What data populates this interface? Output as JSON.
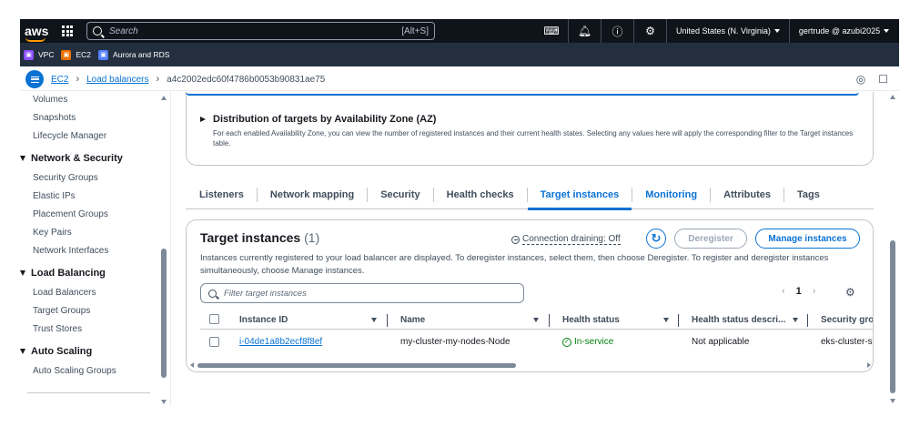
{
  "topnav": {
    "logo": "aws",
    "search_placeholder": "Search",
    "search_shortcut": "[Alt+S]",
    "region": "United States (N. Virginia)",
    "user": "gertrude @ azubi2025"
  },
  "favorites": [
    {
      "label": "VPC",
      "color": "#8c4fff"
    },
    {
      "label": "EC2",
      "color": "#ed7100"
    },
    {
      "label": "Aurora and RDS",
      "color": "#527fff"
    }
  ],
  "breadcrumb": {
    "items": [
      "EC2",
      "Load balancers"
    ],
    "current": "a4c2002edc60f4786b0053b90831ae75"
  },
  "sidebar": {
    "items_top": [
      "Volumes",
      "Snapshots",
      "Lifecycle Manager"
    ],
    "sections": [
      {
        "title": "Network & Security",
        "items": [
          "Security Groups",
          "Elastic IPs",
          "Placement Groups",
          "Key Pairs",
          "Network Interfaces"
        ]
      },
      {
        "title": "Load Balancing",
        "items": [
          "Load Balancers",
          "Target Groups",
          "Trust Stores"
        ]
      },
      {
        "title": "Auto Scaling",
        "items": [
          "Auto Scaling Groups"
        ]
      }
    ]
  },
  "az": {
    "title": "Distribution of targets by Availability Zone (AZ)",
    "desc": "For each enabled Availability Zone, you can view the number of registered instances and their current health states. Selecting any values here will apply the corresponding filter to the Target instances table."
  },
  "tabs": [
    "Listeners",
    "Network mapping",
    "Security",
    "Health checks",
    "Target instances",
    "Monitoring",
    "Attributes",
    "Tags"
  ],
  "active_tab": "Target instances",
  "target_instances": {
    "title": "Target instances",
    "count": "(1)",
    "connection_draining": "Connection draining: Off",
    "deregister_label": "Deregister",
    "manage_label": "Manage instances",
    "desc": "Instances currently registered to your load balancer are displayed. To deregister instances, select them, then choose Deregister. To register and deregister instances simultaneously, choose Manage instances.",
    "filter_placeholder": "Filter target instances",
    "page": "1",
    "columns": [
      "Instance ID",
      "Name",
      "Health status",
      "Health status descri...",
      "Security gro"
    ],
    "rows": [
      {
        "instance_id": "i-04de1a8b2ecf8f8ef",
        "name": "my-cluster-my-nodes-Node",
        "health": "In-service",
        "health_desc": "Not applicable",
        "security_group": "eks-cluster-s"
      }
    ]
  },
  "colors": {
    "accent": "#0972d3",
    "nav": "#0f141a",
    "success": "#037f0c"
  }
}
